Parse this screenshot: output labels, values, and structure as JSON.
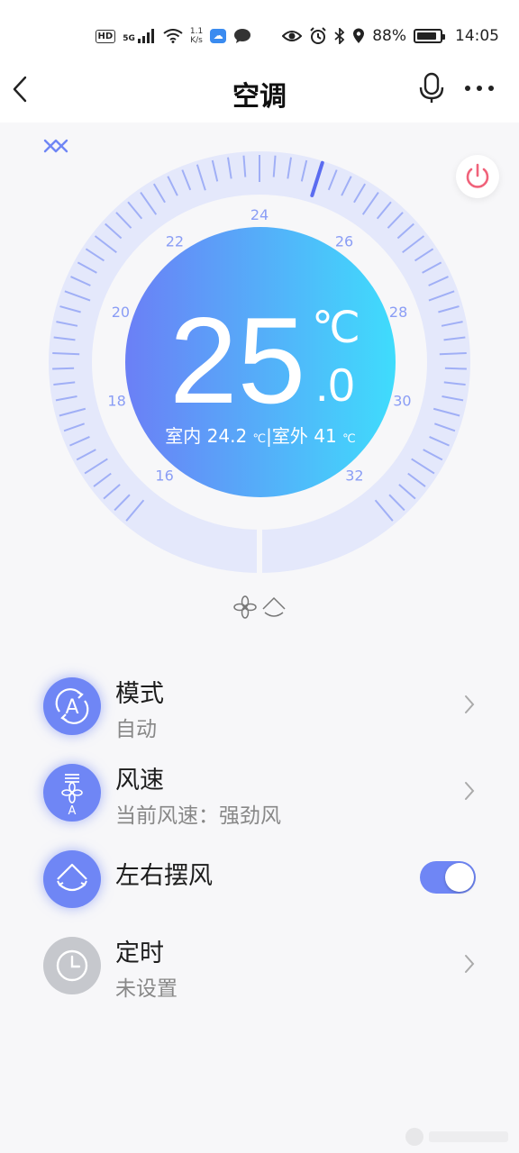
{
  "status_bar": {
    "hd_badge": "HD",
    "network_gen": "5G",
    "net_speed_value": "1.1",
    "net_speed_unit": "K/s",
    "battery_percent": "88%",
    "battery_level": 0.88,
    "time": "14:05"
  },
  "header": {
    "title": "空调"
  },
  "dial": {
    "target_temp_int": "25",
    "target_temp_unit": "℃",
    "target_temp_decimal": ".0",
    "indoor_label": "室内",
    "indoor_value": "24.2",
    "outdoor_label": "|室外",
    "outdoor_value": "41",
    "temp_unit_small": "℃",
    "scale_labels": [
      "16",
      "18",
      "20",
      "22",
      "24",
      "26",
      "28",
      "30",
      "32"
    ],
    "scale_min": 16,
    "scale_max": 32,
    "current_value": 25,
    "colors": {
      "gradient_start": "#6b7ff6",
      "gradient_end": "#3fdcfc",
      "tick": "#8a9df5",
      "ring_bg": "#e4e8fb",
      "pointer": "#5b6cf0"
    }
  },
  "settings": {
    "mode": {
      "title": "模式",
      "value": "自动",
      "icon": "auto-mode-icon"
    },
    "fan": {
      "title": "风速",
      "value": "当前风速：强劲风",
      "icon": "fan-speed-icon"
    },
    "swing": {
      "title": "左右摆风",
      "enabled": true,
      "icon": "swing-icon"
    },
    "timer": {
      "title": "定时",
      "value": "未设置",
      "icon": "clock-icon"
    }
  },
  "accent_color": "#6f86f5",
  "power_color": "#f0627a"
}
